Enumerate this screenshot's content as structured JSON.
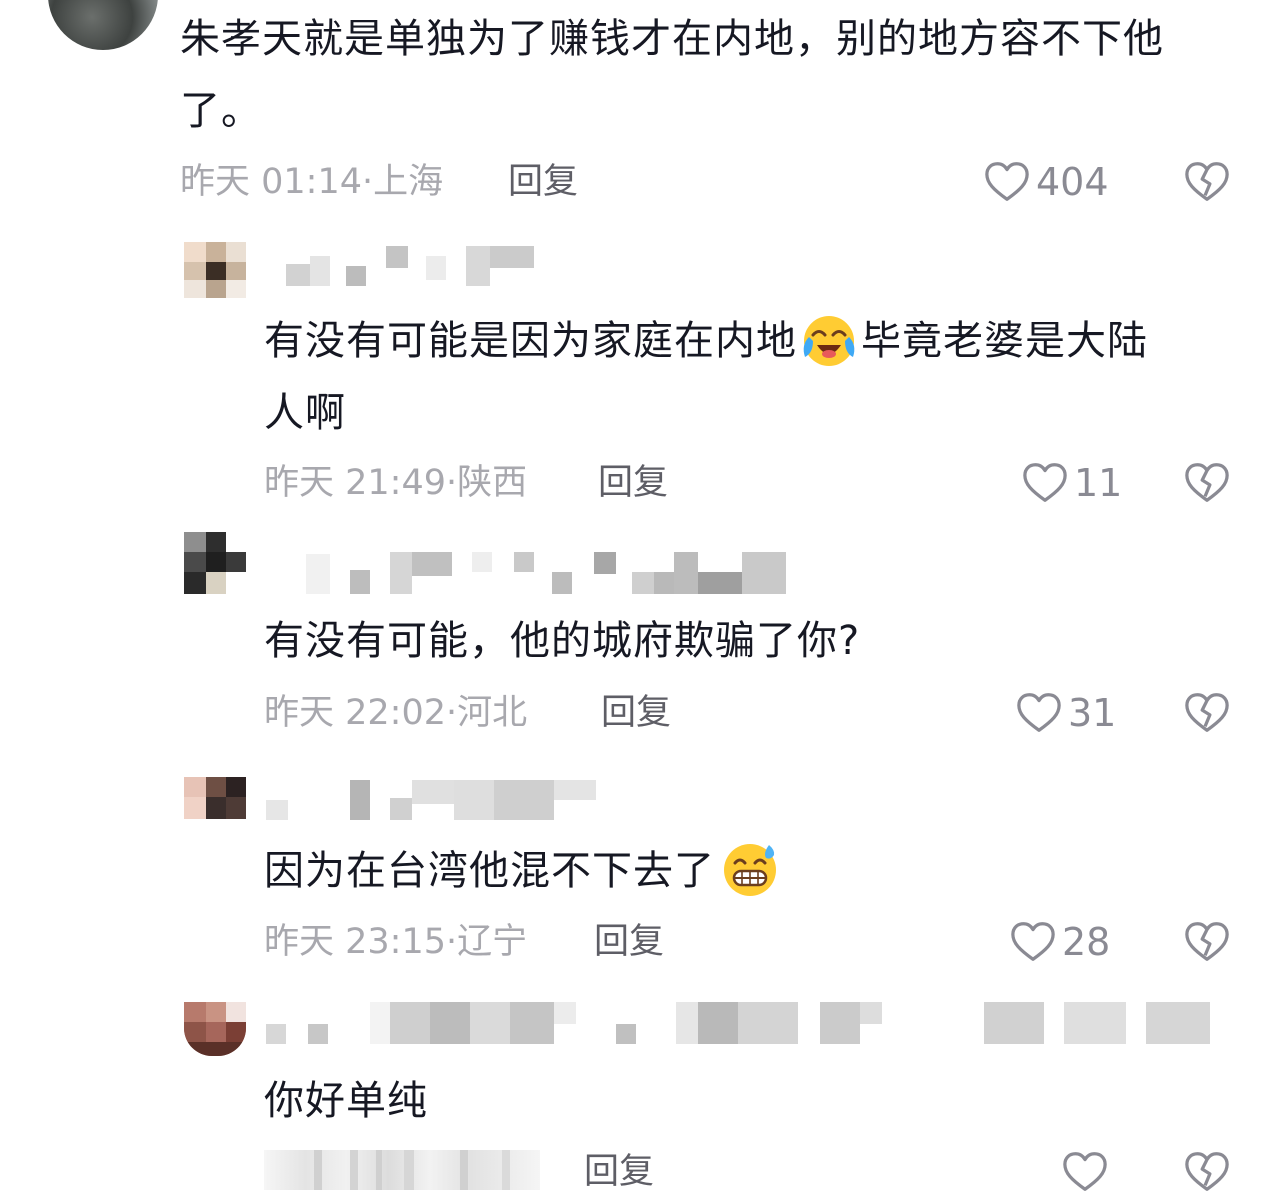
{
  "comments": [
    {
      "text_line1": "朱孝天就是单独为了赚钱才在内地，别的地方容不下他",
      "text_line2": "了。",
      "time": "昨天 01:14",
      "location": "上海",
      "reply_label": "回复",
      "likes": "404"
    },
    {
      "text_a": "有没有可能是因为家庭在内地",
      "emoji": "crying-laughing",
      "text_b": "毕竟老婆是大陆",
      "text_line2": "人啊",
      "time": "昨天 21:49",
      "location": "陕西",
      "reply_label": "回复",
      "likes": "11"
    },
    {
      "text": "有没有可能，他的城府欺骗了你?",
      "time": "昨天 22:02",
      "location": "河北",
      "reply_label": "回复",
      "likes": "31"
    },
    {
      "text": "因为在台湾他混不下去了",
      "emoji": "grinning-sweat",
      "time": "昨天 23:15",
      "location": "辽宁",
      "reply_label": "回复",
      "likes": "28"
    },
    {
      "text": "你好单纯",
      "reply_label": "回复"
    }
  ],
  "meta_separator": "·",
  "icons": {
    "like": "heart-outline-icon",
    "dislike": "broken-heart-icon"
  }
}
